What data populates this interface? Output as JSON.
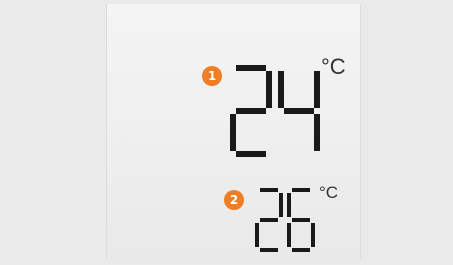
{
  "display": {
    "lcd_color": "#1a1a1a",
    "marker_color": "#f07d24",
    "readings": [
      {
        "marker": "1",
        "value": "24",
        "unit": "°C"
      },
      {
        "marker": "2",
        "value": "26",
        "unit": "°C"
      }
    ]
  }
}
